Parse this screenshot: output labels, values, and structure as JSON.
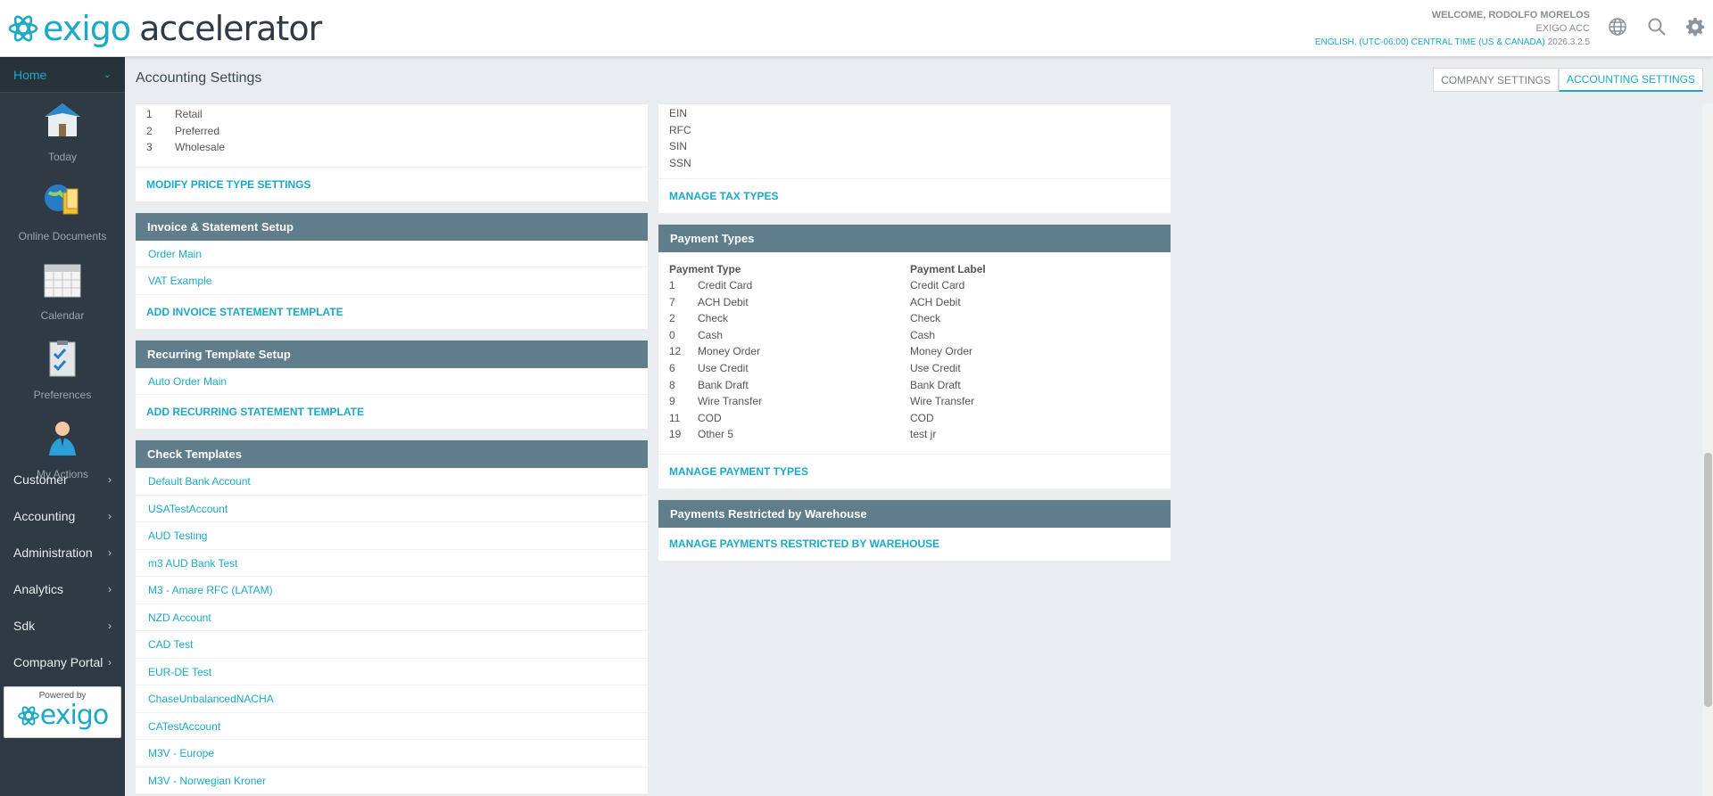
{
  "header": {
    "app_name_part1": "exigo",
    "app_name_part2": "accelerator",
    "welcome": "WELCOME, RODOLFO MORELOS",
    "company": "EXIGO ACC",
    "locale": "ENGLISH, (UTC-06:00) CENTRAL TIME (US & CANADA)",
    "version": "2026.3.2.5",
    "icons": [
      "globe-icon",
      "search-icon",
      "settings-gear-icon"
    ]
  },
  "sidebar": {
    "home_label": "Home",
    "tiles": [
      {
        "label": "Today",
        "icon": "house-icon"
      },
      {
        "label": "Online Documents",
        "icon": "globe-documents-icon"
      },
      {
        "label": "Calendar",
        "icon": "calendar-icon"
      },
      {
        "label": "Preferences",
        "icon": "checklist-icon"
      },
      {
        "label": "My Actions",
        "icon": "person-icon"
      }
    ],
    "menu": [
      "Customer",
      "Accounting",
      "Administration",
      "Analytics",
      "Sdk",
      "Company Portal"
    ],
    "powered_by": "Powered by",
    "powered_logo": "exigo"
  },
  "page": {
    "title": "Accounting Settings",
    "tabs": [
      "COMPANY SETTINGS",
      "ACCOUNTING SETTINGS"
    ],
    "active_tab": "ACCOUNTING SETTINGS"
  },
  "price_types": {
    "rows": [
      {
        "num": "1",
        "name": "Retail"
      },
      {
        "num": "2",
        "name": "Preferred"
      },
      {
        "num": "3",
        "name": "Wholesale"
      }
    ],
    "action": "MODIFY PRICE TYPE SETTINGS"
  },
  "invoice_setup": {
    "title": "Invoice & Statement Setup",
    "items": [
      "Order Main",
      "VAT Example"
    ],
    "action": "ADD INVOICE STATEMENT TEMPLATE"
  },
  "recurring_setup": {
    "title": "Recurring Template Setup",
    "items": [
      "Auto Order Main"
    ],
    "action": "ADD RECURRING STATEMENT TEMPLATE"
  },
  "check_templates": {
    "title": "Check Templates",
    "items": [
      "Default Bank Account",
      "USATestAccount",
      "AUD Testing",
      "m3 AUD Bank Test",
      "M3 - Amare RFC (LATAM)",
      "NZD Account",
      "CAD Test",
      "EUR-DE Test",
      "ChaseUnbalancedNACHA",
      "CATestAccount",
      "M3V - Europe",
      "M3V - Norwegian Kroner"
    ]
  },
  "tax_types": {
    "rows": [
      "EIN",
      "RFC",
      "SIN",
      "SSN"
    ],
    "action": "MANAGE TAX TYPES"
  },
  "payment_types": {
    "title": "Payment Types",
    "col1": "Payment Type",
    "col2": "Payment Label",
    "rows": [
      {
        "num": "1",
        "type": "Credit Card",
        "label": "Credit Card"
      },
      {
        "num": "7",
        "type": "ACH Debit",
        "label": "ACH Debit"
      },
      {
        "num": "2",
        "type": "Check",
        "label": "Check"
      },
      {
        "num": "0",
        "type": "Cash",
        "label": "Cash"
      },
      {
        "num": "12",
        "type": "Money Order",
        "label": "Money Order"
      },
      {
        "num": "6",
        "type": "Use Credit",
        "label": "Use Credit"
      },
      {
        "num": "8",
        "type": "Bank Draft",
        "label": "Bank Draft"
      },
      {
        "num": "9",
        "type": "Wire Transfer",
        "label": "Wire Transfer"
      },
      {
        "num": "11",
        "type": "COD",
        "label": "COD"
      },
      {
        "num": "19",
        "type": "Other 5",
        "label": "test jr"
      }
    ],
    "action": "MANAGE PAYMENT TYPES"
  },
  "restricted": {
    "title": "Payments Restricted by Warehouse",
    "action": "MANAGE PAYMENTS RESTRICTED BY WAREHOUSE"
  },
  "colors": {
    "accent": "#1ba9c6",
    "sidebar": "#2f3a44",
    "panel_header": "#607d8b",
    "background": "#e9edf0"
  }
}
